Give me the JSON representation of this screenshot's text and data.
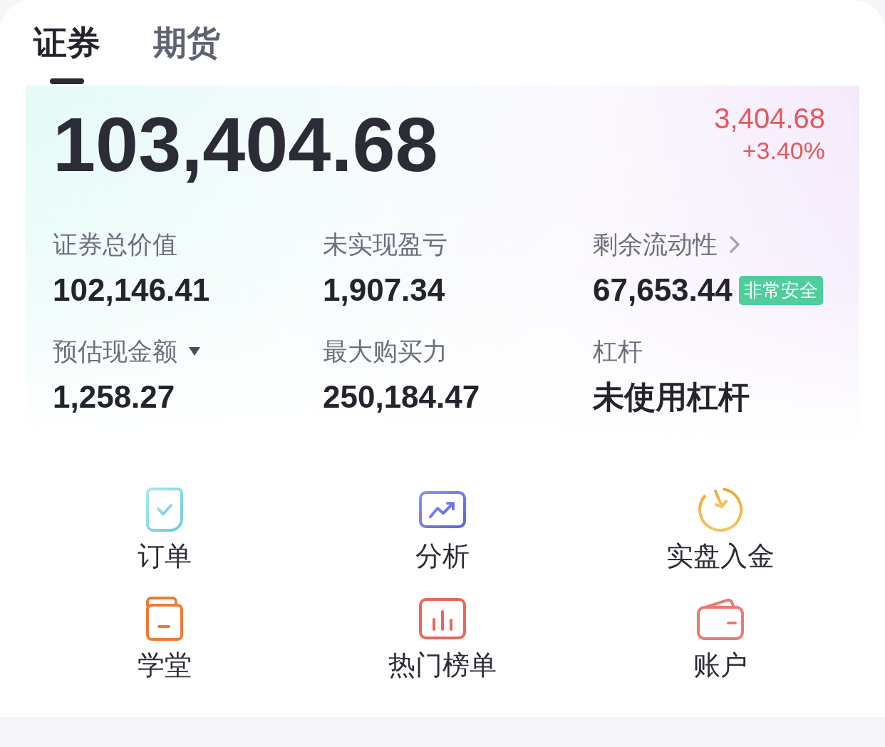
{
  "tabs": [
    {
      "label": "证券",
      "selected": true
    },
    {
      "label": "期货",
      "selected": false
    }
  ],
  "summary": {
    "total": "103,404.68",
    "change": "3,404.68",
    "change_percent": "+3.40%",
    "rising": true
  },
  "metrics": [
    {
      "kind": "plain",
      "label": "证券总价值",
      "value": "102,146.41"
    },
    {
      "kind": "plain",
      "label": "未实现盈亏",
      "value": "1,907.34"
    },
    {
      "kind": "link",
      "label": "剩余流动性",
      "value": "67,653.44",
      "badge": "非常安全"
    },
    {
      "kind": "menu",
      "label": "预估现金额",
      "value": "1,258.27"
    },
    {
      "kind": "plain",
      "label": "最大购买力",
      "value": "250,184.47"
    },
    {
      "kind": "plain",
      "label": "杠杆",
      "value": "未使用杠杆"
    }
  ],
  "shortcuts": [
    {
      "kind": "orders",
      "label": "订单"
    },
    {
      "kind": "analysis",
      "label": "分析"
    },
    {
      "kind": "deposit",
      "label": "实盘入金"
    },
    {
      "kind": "learning",
      "label": "学堂"
    },
    {
      "kind": "ranking",
      "label": "热门榜单"
    },
    {
      "kind": "account",
      "label": "账户"
    }
  ]
}
